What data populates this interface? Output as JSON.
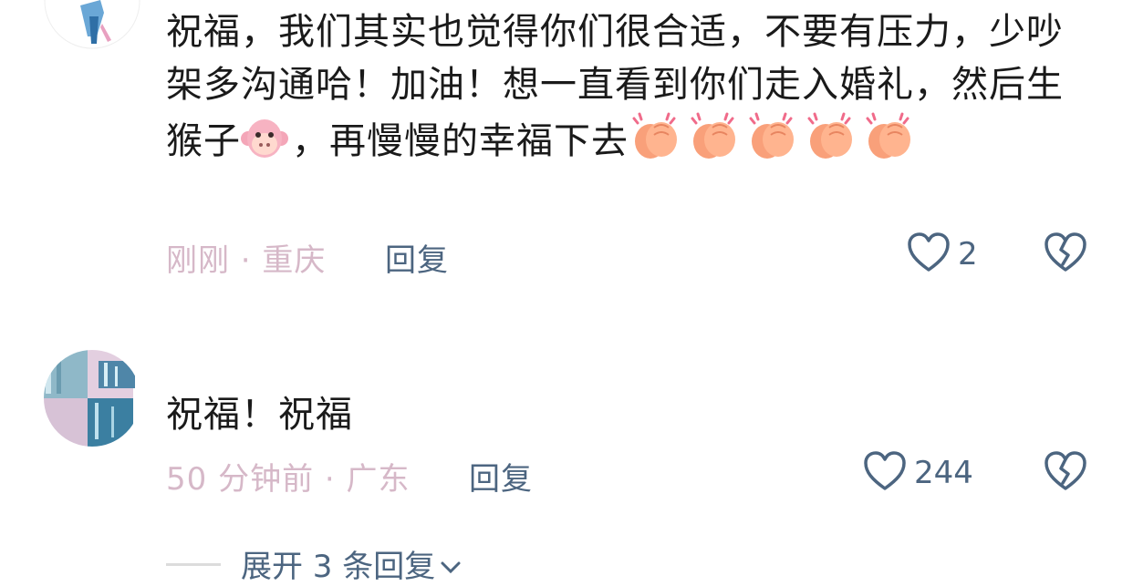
{
  "comments": [
    {
      "text_parts": [
        "祝福，我们其实也觉得你们很合适，不要有压力，少吵架多沟通哈！加油！想一直看到你们走入婚礼，然后生猴子",
        "，再慢慢的幸福下去"
      ],
      "emojis": [
        "monkey-face",
        "clapping-hands",
        "clapping-hands",
        "clapping-hands",
        "clapping-hands",
        "clapping-hands"
      ],
      "meta": "刚刚 · 重庆",
      "reply_label": "回复",
      "likes": "2"
    },
    {
      "text": "祝福！祝福",
      "meta": "50 分钟前 · 广东",
      "reply_label": "回复",
      "likes": "244"
    }
  ],
  "expand_replies_label": "展开 3 条回复",
  "icons": {
    "like": "heart-outline-icon",
    "dislike": "broken-heart-icon",
    "expand": "chevron-down-icon"
  },
  "colors": {
    "text": "#1a1a1a",
    "meta": "#d6b8c8",
    "action": "#4c6580"
  }
}
